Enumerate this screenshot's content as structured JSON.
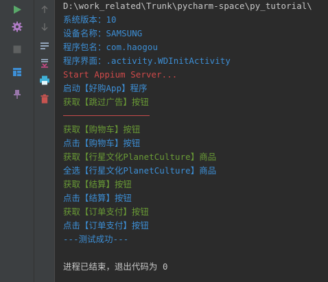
{
  "colors": {
    "background": "#2b2b2b",
    "toolbar": "#3c3f41",
    "default_text": "#a9b7c6",
    "blue_text": "#3d8fd6",
    "green_text": "#6a9b36",
    "red_text": "#d04a4a",
    "run_green": "#59a869",
    "stop_gray": "#5e6060",
    "delete_red": "#c75450",
    "accent_purple": "#9876aa",
    "print_cyan": "#3fb0d6"
  },
  "toolbar": {
    "run_icon": "play-icon",
    "settings_icon": "gear-icon",
    "stop_icon": "stop-icon",
    "layout_icon": "layout-icon",
    "pin_icon": "pin-icon",
    "up_icon": "arrow-up-icon",
    "down_icon": "arrow-down-icon",
    "wrap_icon": "soft-wrap-icon",
    "scroll_end_icon": "scroll-to-end-icon",
    "print_icon": "print-icon",
    "clear_icon": "trash-icon"
  },
  "console": {
    "lines": [
      {
        "text": "D:\\work_related\\Trunk\\pycharm-space\\py_tutorial\\"
      },
      {
        "text": "系统版本：10"
      },
      {
        "text": "设备名称：SAMSUNG"
      },
      {
        "text": "程序包名：com.haogou"
      },
      {
        "text": "程序界面：.activity.WDInitActivity"
      },
      {
        "text": "Start Appium Server..."
      },
      {
        "text": "启动【好购App】程序"
      },
      {
        "text": "获取【跳过广告】按钮"
      },
      {
        "text": ""
      },
      {
        "text": "获取【购物车】按钮"
      },
      {
        "text": "点击【购物车】按钮"
      },
      {
        "text": "获取【行星文化PlanetCulture】商品"
      },
      {
        "text": "全选【行星文化PlanetCulture】商品"
      },
      {
        "text": "获取【结算】按钮"
      },
      {
        "text": "点击【结算】按钮"
      },
      {
        "text": "获取【订单支付】按钮"
      },
      {
        "text": "点击【订单支付】按钮"
      },
      {
        "text": "---测试成功---"
      },
      {
        "text": ""
      },
      {
        "text": "进程已结束，退出代码为 0"
      }
    ]
  }
}
